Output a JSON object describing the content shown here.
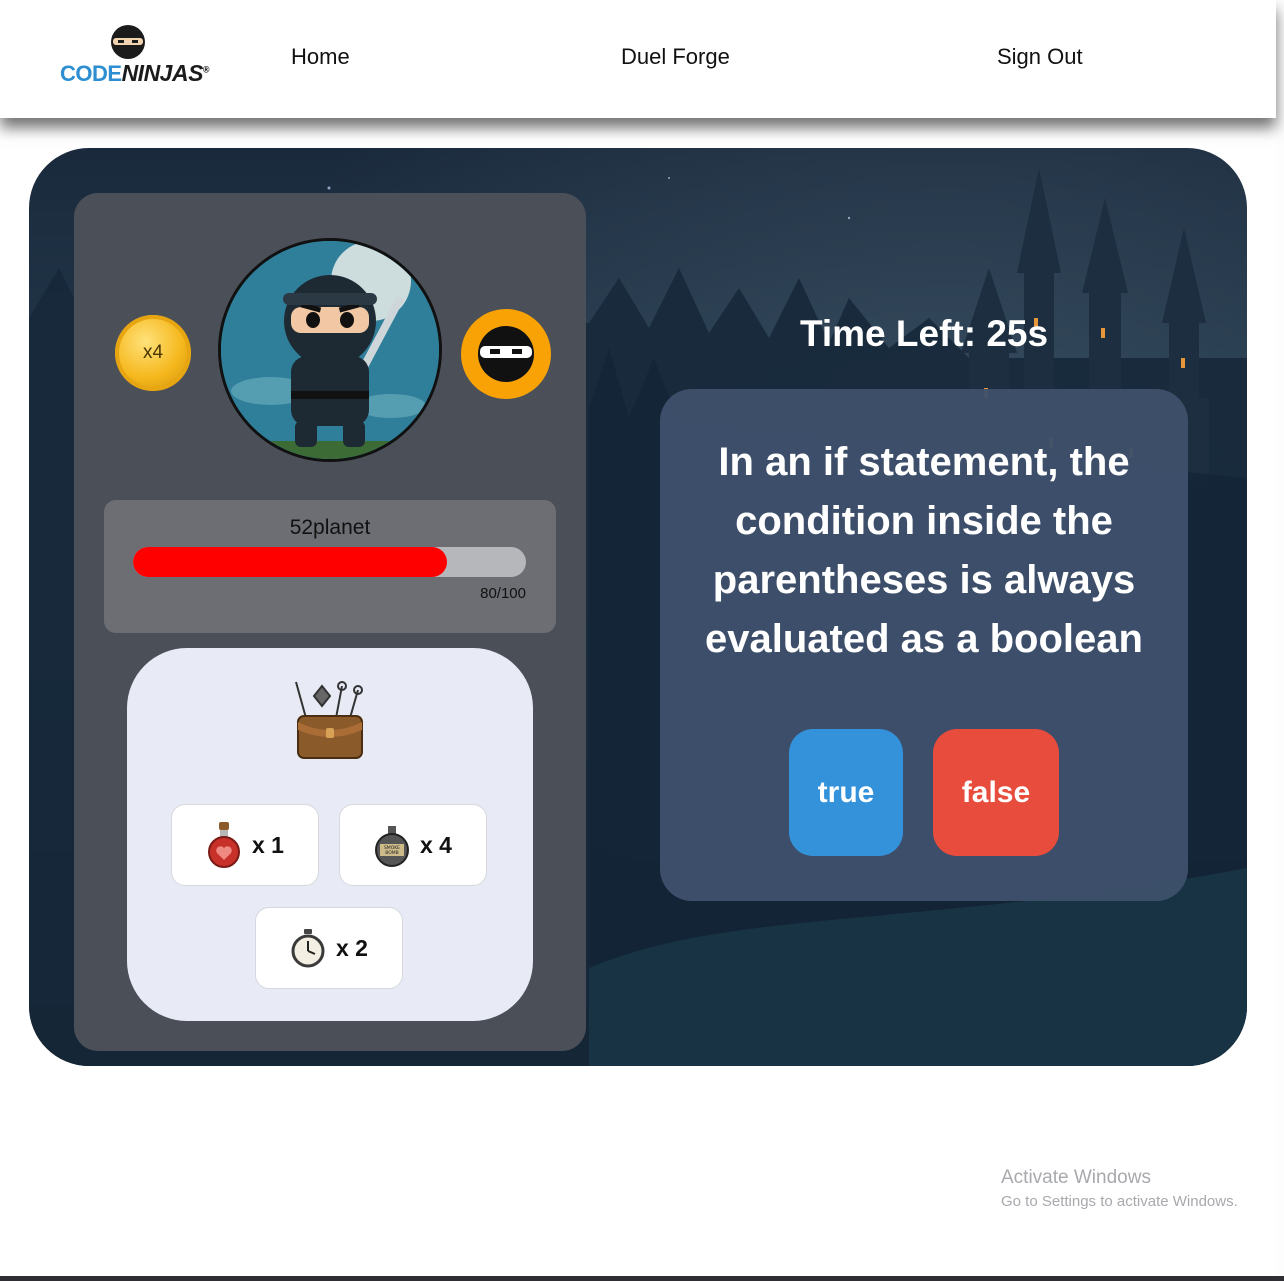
{
  "nav": {
    "logo_code": "CODE",
    "logo_ninjas": "NINJAS",
    "logo_mark": "®",
    "home": "Home",
    "duel_forge": "Duel Forge",
    "sign_out": "Sign Out"
  },
  "player": {
    "coin_count": "x4",
    "name": "52planet",
    "hp_text": "80/100",
    "hp_fraction": 0.8
  },
  "inventory": {
    "items": [
      {
        "icon": "health-potion-icon",
        "qty": "x 1"
      },
      {
        "icon": "smoke-bomb-icon",
        "qty": "x 4",
        "label": "SMOKE BOMB"
      },
      {
        "icon": "stopwatch-icon",
        "qty": "x 2"
      }
    ]
  },
  "duel": {
    "timer": "Time Left: 25s",
    "question": "In an if statement, the condition inside the parentheses is always evaluated as a boolean",
    "answer_true": "true",
    "answer_false": "false"
  },
  "watermark": {
    "title": "Activate Windows",
    "subtitle": "Go to Settings to activate Windows."
  },
  "colors": {
    "hp_fill": "#ff0000",
    "true_button": "#3492db",
    "false_button": "#e74c3c",
    "badge": "#f9a206",
    "coin": "#f5b71c"
  }
}
